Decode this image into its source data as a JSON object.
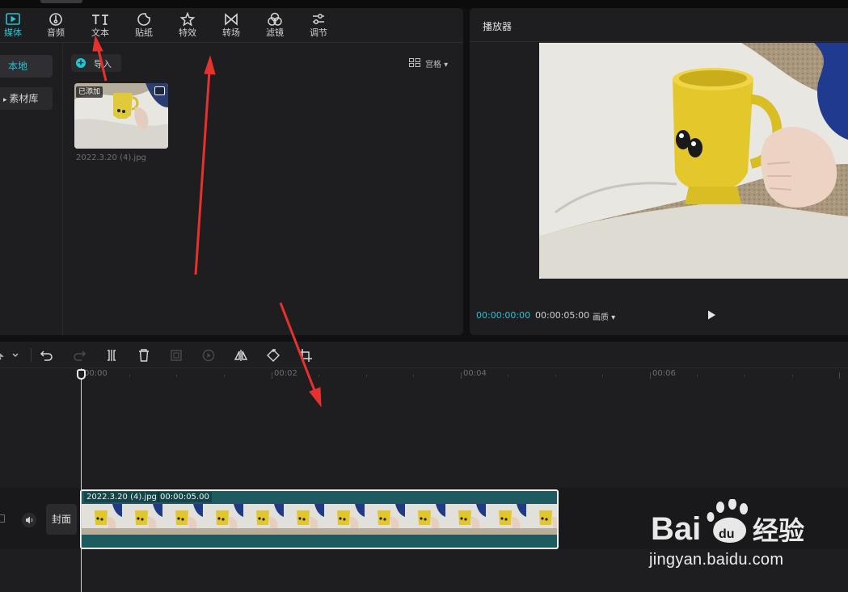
{
  "toolbar": {
    "items": [
      {
        "label": "媒体",
        "icon": "media-icon",
        "active": true
      },
      {
        "label": "音频",
        "icon": "audio-icon"
      },
      {
        "label": "文本",
        "icon": "text-icon"
      },
      {
        "label": "贴纸",
        "icon": "sticker-icon"
      },
      {
        "label": "特效",
        "icon": "effects-icon"
      },
      {
        "label": "转场",
        "icon": "transition-icon"
      },
      {
        "label": "滤镜",
        "icon": "filter-icon"
      },
      {
        "label": "调节",
        "icon": "adjust-icon"
      }
    ]
  },
  "sidebar": {
    "items": [
      {
        "label": "本地",
        "active": true
      },
      {
        "label": "素材库"
      }
    ]
  },
  "media": {
    "import_label": "导入",
    "view_label": "宫格",
    "asset": {
      "added_badge": "已添加",
      "filename": "2022.3.20 (4).jpg"
    }
  },
  "player": {
    "title": "播放器",
    "current_time": "00:00:00:00",
    "duration": "00:00:05:00",
    "quality_label": "画质"
  },
  "timeline": {
    "ruler": [
      {
        "label": "00:00"
      },
      {
        "label": "00:02"
      },
      {
        "label": "00:04"
      },
      {
        "label": "00:06"
      }
    ],
    "cover_label": "封面",
    "clip": {
      "name": "2022.3.20 (4).jpg",
      "duration": "00:00:05.00"
    }
  },
  "watermark": {
    "text": "Baidu经验",
    "url": "jingyan.baidu.com"
  },
  "colors": {
    "accent": "#22c4d4",
    "clip": "#1c5c61",
    "arrow": "#e8302e"
  }
}
